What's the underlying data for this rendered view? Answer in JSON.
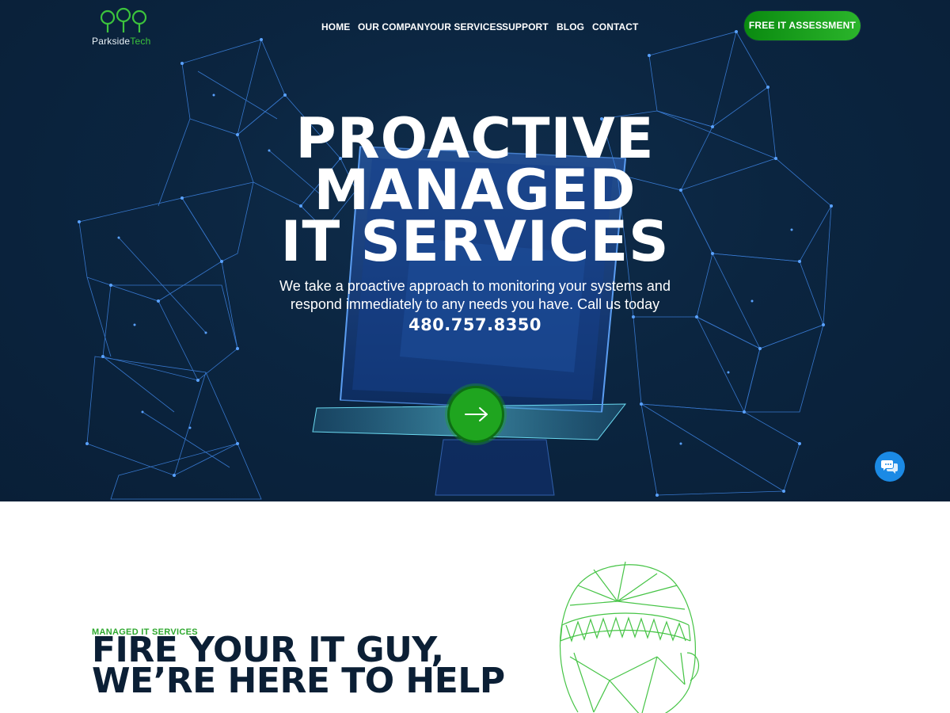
{
  "brand": {
    "name_part1": "Parkside",
    "name_part2": "Tech",
    "logo_icon": "tree-cluster-icon",
    "accent_color": "#3cc43c"
  },
  "nav": {
    "items": [
      {
        "label": "HOME"
      },
      {
        "label": "OUR COMPANY"
      },
      {
        "label": "OUR SERVICES"
      },
      {
        "label": "SUPPORT"
      },
      {
        "label": "BLOG"
      },
      {
        "label": "CONTACT"
      }
    ],
    "cta_label": "FREE IT ASSESSMENT"
  },
  "hero": {
    "headline_line1": "PROACTIVE",
    "headline_line2": "MANAGED",
    "headline_line3": "IT SERVICES",
    "subtext_line1": "We take a proactive approach to monitoring your systems and",
    "subtext_line2": "respond immediately to any needs you have. Call us today",
    "phone": "480.757.8350",
    "go_icon": "arrow-right-icon",
    "background_color": "#0b2540"
  },
  "chat": {
    "icon": "chat-bubbles-icon",
    "color": "#1b8ae5"
  },
  "section": {
    "eyebrow": "MANAGED IT SERVICES",
    "title_line1": "FIRE YOUR IT GUY,",
    "title_line2": "WE’RE HERE TO HELP",
    "title_color": "#0b1f35",
    "image": "wireframe-head-icon"
  }
}
